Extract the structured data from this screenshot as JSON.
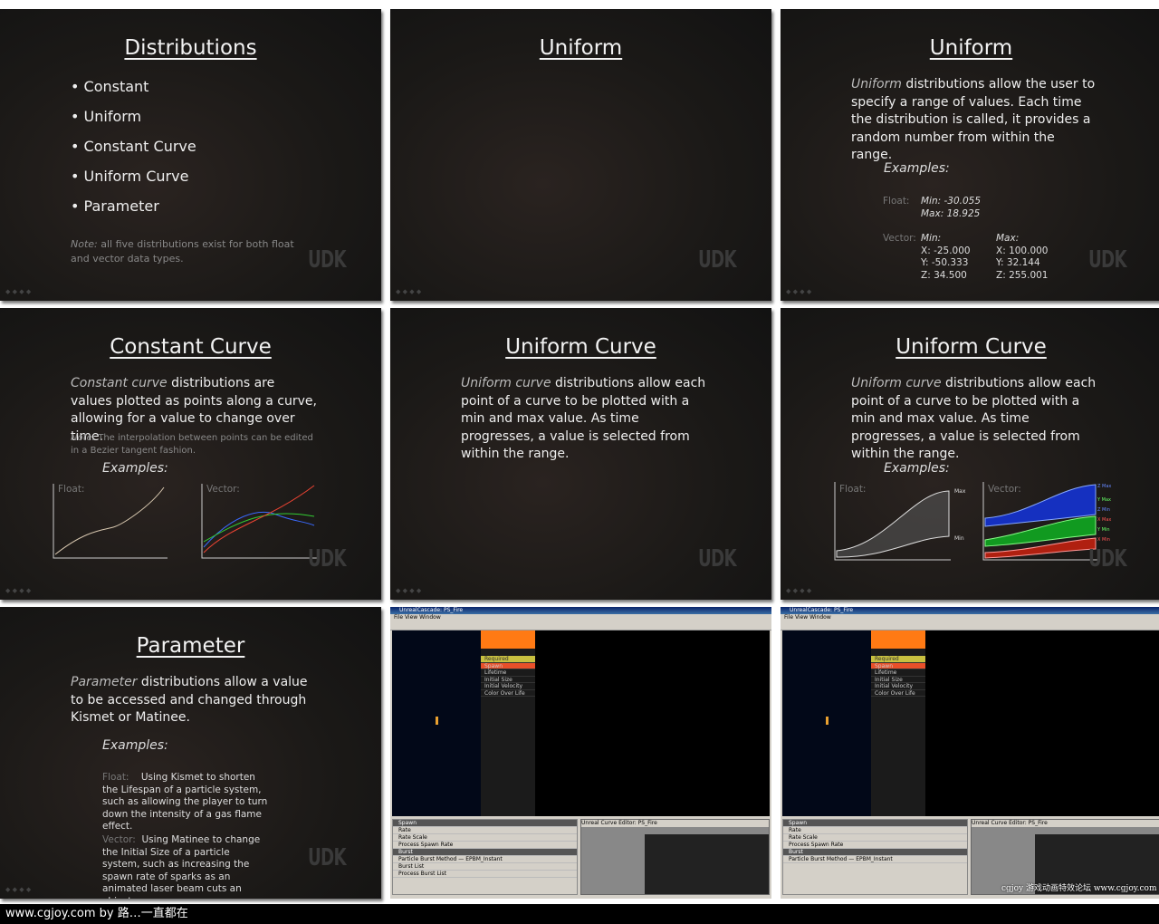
{
  "slides": {
    "distributions": {
      "title": "Distributions",
      "bullets": [
        "• Constant",
        "• Uniform",
        "• Constant Curve",
        "• Uniform Curve",
        "• Parameter"
      ],
      "note_label": "Note:",
      "note": " all five distributions exist for both float and vector data types."
    },
    "uniform_blank": {
      "title": "Uniform"
    },
    "uniform": {
      "title": "Uniform",
      "italic": "Uniform",
      "text": " distributions allow the user to specify a range of values. Each time the distribution is called, it provides a random number from within the range.",
      "examples": "Examples:",
      "float_label": "Float:",
      "float_min": "Min: -30.055",
      "float_max": "Max: 18.925",
      "vector_label": "Vector:",
      "min_head": "Min:",
      "max_head": "Max:",
      "vmin": [
        "X: -25.000",
        "Y: -50.333",
        "Z: 34.500"
      ],
      "vmax": [
        "X: 100.000",
        "Y: 32.144",
        "Z: 255.001"
      ]
    },
    "constant_curve": {
      "title": "Constant Curve",
      "italic": "Constant curve",
      "text": " distributions are values plotted as points along a curve, allowing for a value to change over time.",
      "note_label": "Note:",
      "note": " The interpolation between points can be edited in a Bezier tangent fashion.",
      "examples": "Examples:",
      "float_label": "Float:",
      "vector_label": "Vector:"
    },
    "uniform_curve_a": {
      "title": "Uniform Curve",
      "italic": "Uniform curve",
      "text": " distributions allow each point of a curve to be plotted with a min and max value. As time progresses, a value is selected from within the range."
    },
    "uniform_curve_b": {
      "title": "Uniform Curve",
      "italic": "Uniform curve",
      "text": " distributions allow each point of a curve to be plotted with a min and max value. As time progresses, a value is selected from within the range.",
      "examples": "Examples:",
      "float_label": "Float:",
      "vector_label": "Vector:",
      "max": "Max",
      "min": "Min",
      "vector_labels": [
        "Z Max",
        "Y Max",
        "Z Min",
        "X Max",
        "Y Min",
        "X Min"
      ]
    },
    "parameter": {
      "title": "Parameter",
      "italic": "Parameter",
      "text": " distributions allow a value to be accessed and changed through Kismet or Matinee.",
      "examples": "Examples:",
      "float_label": "Float:",
      "float_text": "Using Kismet to shorten the Lifespan of a particle system, such as allowing the player to turn down the intensity of a gas flame effect.",
      "vector_label": "Vector:",
      "vector_text": "Using Matinee to change the Initial Size of a particle system, such as increasing the spawn rate of sparks as an animated laser beam cuts an object."
    }
  },
  "watermark": "UDK",
  "editor": {
    "title": "UnrealCascade: PS_Fire",
    "menu": "File  View  Window",
    "modules": [
      "Required",
      "Spawn",
      "Lifetime",
      "Initial Size",
      "Initial Velocity",
      "Color Over Life"
    ],
    "props_rows": [
      "Spawn",
      "Rate",
      "Rate Scale",
      "Process Spawn Rate",
      "Burst",
      "Particle Burst Method",
      "Burst List",
      "Process Burst List"
    ],
    "curve_title": "Unreal Curve Editor: PS_Fire",
    "burst_method": "EPBM_Instant"
  },
  "colors": {
    "spawn": "#e8502a",
    "required": "#c8c040",
    "emitter": "#ff7a14"
  },
  "footer": "www.cgjoy.com by 路…一直都在",
  "logo": "cgjoy 游戏动画特效论坛 www.cgjoy.com"
}
